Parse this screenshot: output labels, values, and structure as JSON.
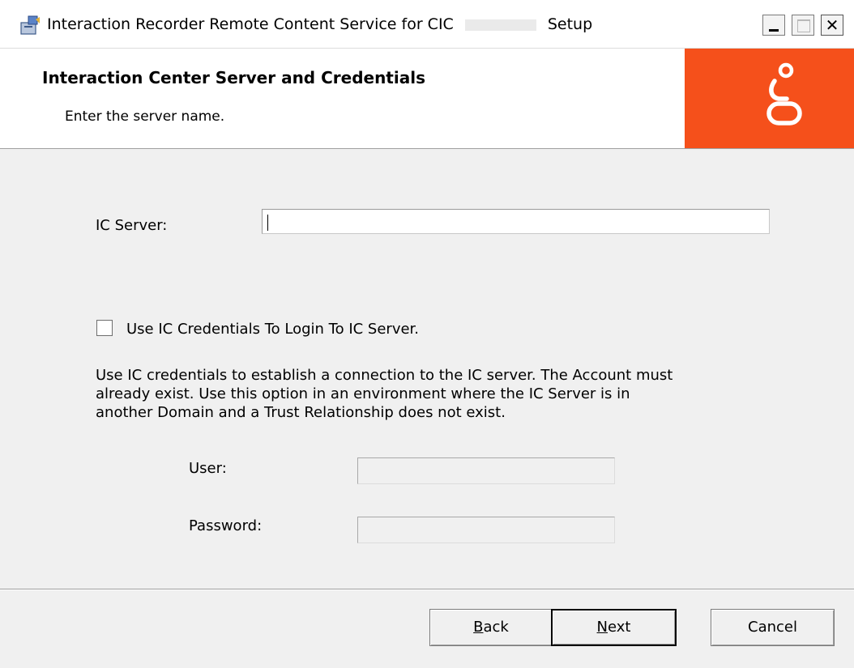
{
  "window": {
    "title_before": "Interaction Recorder Remote Content Service for CIC",
    "title_after": "Setup",
    "controls": {
      "minimize": "minimize-icon",
      "maximize": "maximize-icon",
      "close": "close-icon"
    }
  },
  "header": {
    "title": "Interaction Center Server and Credentials",
    "subtitle": "Enter the server name.",
    "logo_color": "#f5501b"
  },
  "form": {
    "server_label": "IC Server:",
    "server_value": "",
    "checkbox_label": "Use IC Credentials To Login To IC Server.",
    "checkbox_checked": false,
    "description": "Use IC credentials to establish a connection to the IC server.  The Account must\nalready exist.  Use this option in an environment where the IC Server is in\nanother Domain and a Trust Relationship does not exist.",
    "user_label": "User:",
    "user_value": "",
    "password_label": "Password:",
    "password_value": ""
  },
  "footer": {
    "back": {
      "access_key": "B",
      "rest": "ack"
    },
    "next": {
      "access_key": "N",
      "rest": "ext"
    },
    "cancel": "Cancel"
  }
}
